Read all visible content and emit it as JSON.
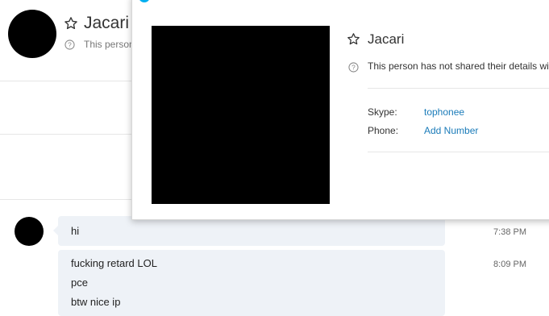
{
  "contact": {
    "name": "Jacari",
    "status_short": "This person",
    "status_full": "This person has not shared their details wit"
  },
  "profile": {
    "skype_label": "Skype:",
    "skype_value": "tophonee",
    "phone_label": "Phone:",
    "phone_value": "Add Number"
  },
  "messages": [
    {
      "lines": [
        "hi"
      ],
      "time": "7:38 PM"
    },
    {
      "lines": [
        "fucking retard LOL",
        "pce",
        "btw nice ip"
      ],
      "time": "8:09 PM"
    }
  ],
  "colors": {
    "link": "#1a7bb9",
    "bubble": "#eef2f7",
    "brand": "#00aff0"
  },
  "icons": {
    "favorite": "star-outline-icon",
    "help": "question-circle-icon"
  }
}
